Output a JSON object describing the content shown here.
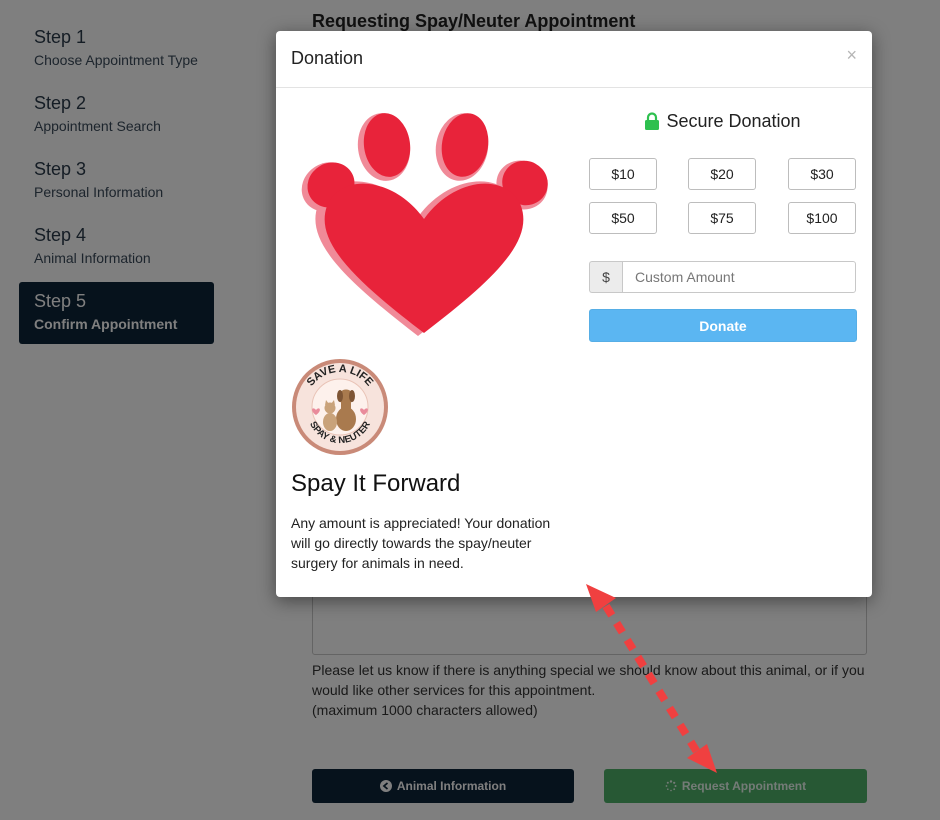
{
  "sidebar": {
    "steps": [
      {
        "num": "Step 1",
        "label": "Choose Appointment Type"
      },
      {
        "num": "Step 2",
        "label": "Appointment Search"
      },
      {
        "num": "Step 3",
        "label": "Personal Information"
      },
      {
        "num": "Step 4",
        "label": "Animal Information"
      },
      {
        "num": "Step 5",
        "label": "Confirm Appointment"
      }
    ]
  },
  "page": {
    "title": "Requesting Spay/Neuter Appointment",
    "help_line1": "Please let us know if there is anything special we should know about this animal, or if you would like other services for this appointment.",
    "help_line2": "(maximum 1000 characters allowed)",
    "prev_button": "Animal Information",
    "next_button": "Request Appointment"
  },
  "modal": {
    "title": "Donation",
    "close": "×",
    "secure_label": "Secure Donation",
    "amounts": [
      "$10",
      "$20",
      "$30",
      "$50",
      "$75",
      "$100"
    ],
    "currency_symbol": "$",
    "custom_placeholder": "Custom Amount",
    "donate_button": "Donate",
    "forward_title": "Spay It Forward",
    "forward_text": "Any amount is appreciated! Your donation will go directly towards the spay/neuter surgery for animals in need.",
    "badge_top_text": "SAVE A LIFE",
    "badge_bottom_text": "SPAY & NEUTER"
  },
  "colors": {
    "navy": "#0d2438",
    "green": "#4fb068",
    "donate_blue": "#5bb6f2",
    "lock_green": "#2ec04f",
    "paw_red": "#e8233a",
    "arrow_red": "#f04040"
  },
  "icons": {
    "lock": "lock-icon",
    "prev": "arrow-circle-left-icon",
    "next": "spinner-icon",
    "logo": "paw-heart-logo"
  }
}
